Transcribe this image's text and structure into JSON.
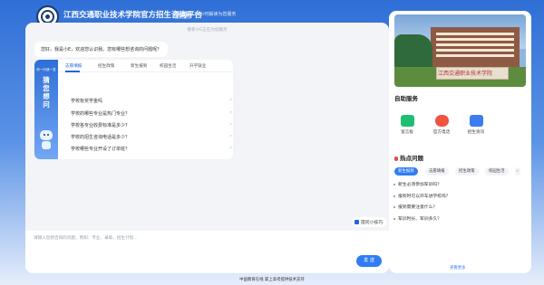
{
  "header": {
    "title": "江西交通职业技术学院官方招生咨询平台",
    "beta_badge": "测试版",
    "slogan": "24小时解读为您服务"
  },
  "chat": {
    "notice": "春新小E正在为您服务",
    "greeting": "您好，我是小E，欢迎您认识我。您有哪些想咨询的问题呢？",
    "faq": {
      "banner_small": "你一问我一答",
      "banner_big": "猜您想问",
      "tabs": [
        "志愿填报",
        "招生政策",
        "新生报到",
        "校园生活",
        "升学就业"
      ],
      "active_tab": 0,
      "questions": [
        "学校有奖学金吗",
        "学校的哪些专业是热门专业？",
        "学校各专业收费标准是多少？",
        "学校的招生咨询电话是多少？",
        "学校哪些专业开设了订单班？"
      ]
    },
    "tips_button": "提问小技巧",
    "input_placeholder": "请输入您想咨询的问题，例如：专业、录取、招生计划...",
    "send_label": "发 送"
  },
  "sidebar": {
    "campus_sign": "江西交通职业技术学院",
    "services_title": "自助服务",
    "services": [
      {
        "label": "留言板",
        "icon": "message-board-icon",
        "color": "#1fbf72"
      },
      {
        "label": "官方电话",
        "icon": "phone-icon",
        "color": "#f0533e"
      },
      {
        "label": "招生资讯",
        "icon": "news-icon",
        "color": "#3d7cf0"
      }
    ],
    "hot_title": "热点问题",
    "hot_tabs": [
      "新生报到",
      "志愿填报",
      "招生政策",
      "校园生活"
    ],
    "active_hot_tab": 0,
    "hot_questions": [
      "新生必须参加军训吗？",
      "报到时可以开车进学校吗？",
      "报到需要注意什么？",
      "军训时长、军训多久？"
    ],
    "more_label": "查看更多"
  },
  "footer": "中国教育在线 掌上高考提供技术支持"
}
